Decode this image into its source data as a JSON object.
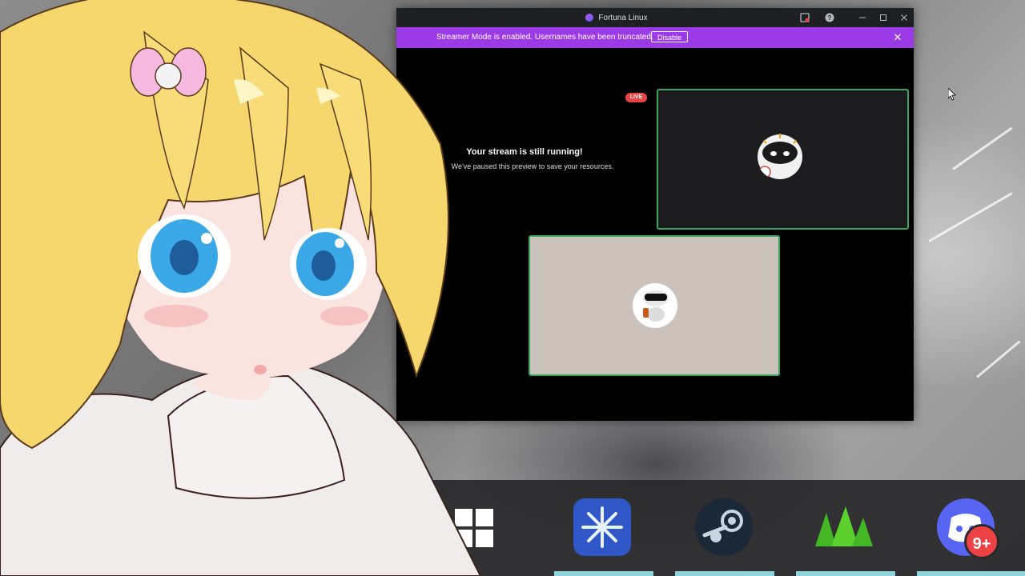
{
  "window": {
    "title": "Fortuna Linux",
    "titlebar_icons": [
      "screen-record-icon",
      "help-icon",
      "minimize-icon",
      "maximize-icon",
      "close-icon"
    ]
  },
  "banner": {
    "message": "Streamer Mode is enabled. Usernames have been truncated.",
    "button_label": "Disable",
    "color": "#9b3be8"
  },
  "stream": {
    "live_label": "LIVE",
    "paused_title": "Your stream is still running!",
    "paused_subtitle": "We've paused this preview to save your resources."
  },
  "tiles": {
    "border_color": "#3ba55d"
  },
  "taskbar": {
    "apps": [
      "windows-start-icon",
      "snowflake-app-icon",
      "steam-icon",
      "green-mountain-app-icon",
      "discord-icon"
    ],
    "discord_badge": "9+"
  }
}
